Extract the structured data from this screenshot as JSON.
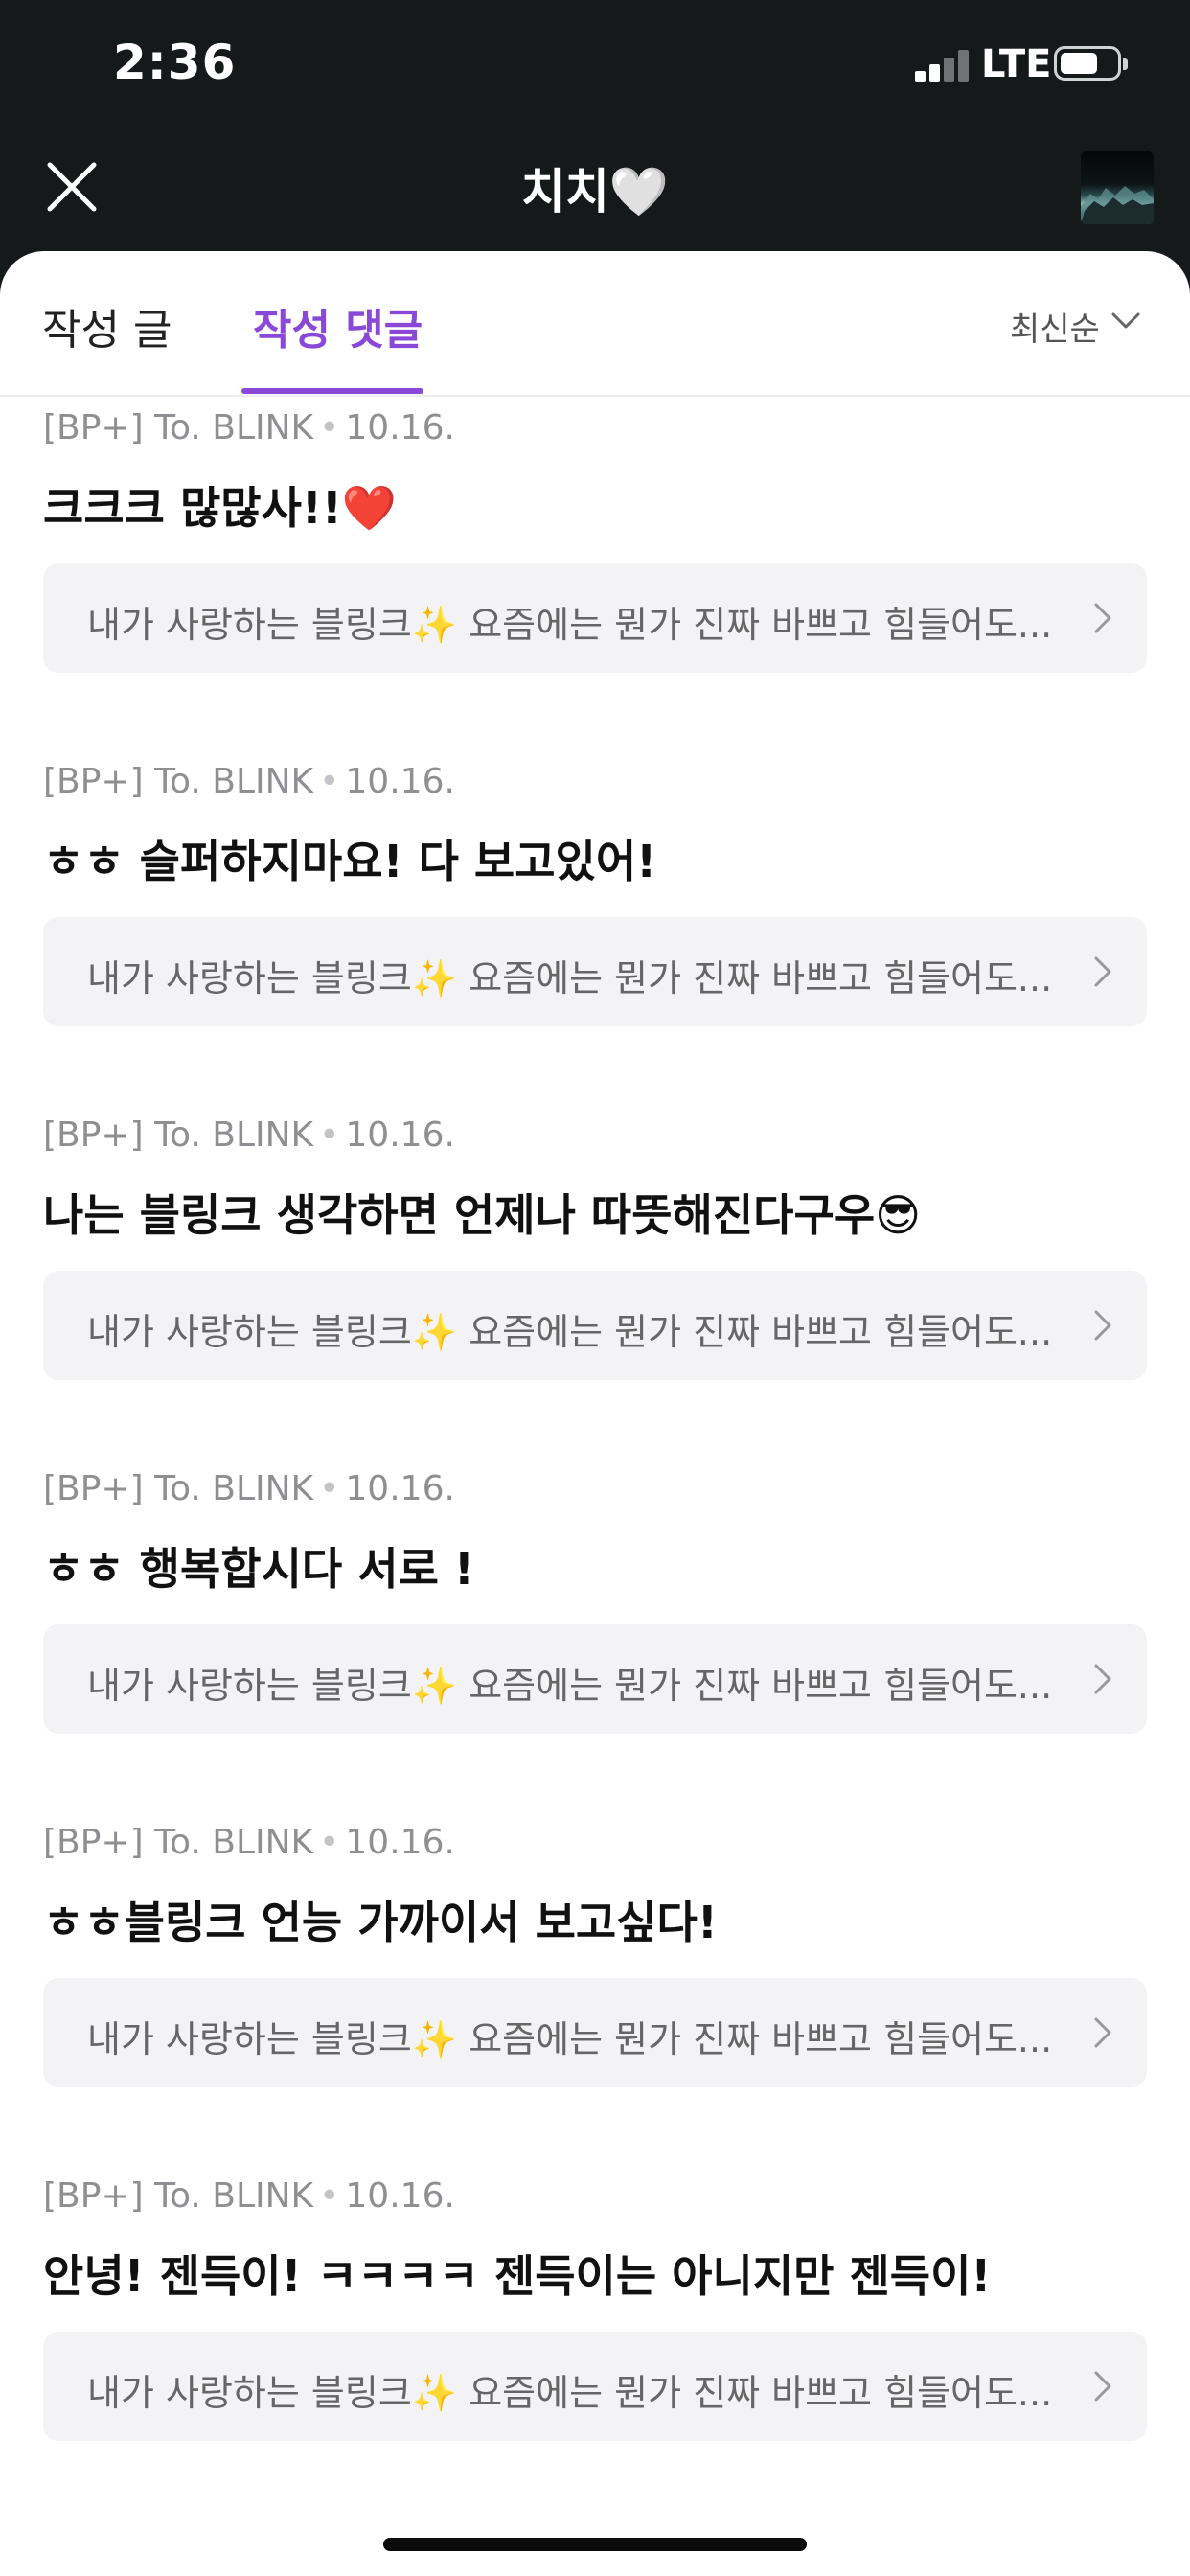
{
  "status_bar": {
    "time": "2:36",
    "network": "LTE"
  },
  "header": {
    "title": "치치🤍",
    "close_icon": "close-icon",
    "avatar_icon": "profile-avatar"
  },
  "tabs": [
    {
      "label": "작성 글",
      "active": false
    },
    {
      "label": "작성 댓글",
      "active": true
    }
  ],
  "sort": {
    "label": "최신순",
    "icon": "chevron-down-icon"
  },
  "accent_color": "#8a48d8",
  "comments": [
    {
      "source": "[BP+] To. BLINK",
      "date": "10.16.",
      "text": "크크크 많많사!!❤️",
      "post_preview": "내가 사랑하는 블링크✨ 요즘에는 뭔가 진짜 바쁘고 힘들어도..."
    },
    {
      "source": "[BP+] To. BLINK",
      "date": "10.16.",
      "text": "ㅎㅎ 슬퍼하지마요! 다 보고있어!",
      "post_preview": "내가 사랑하는 블링크✨ 요즘에는 뭔가 진짜 바쁘고 힘들어도..."
    },
    {
      "source": "[BP+] To. BLINK",
      "date": "10.16.",
      "text": "나는 블링크 생각하면 언제나 따뜻해진다구우😎",
      "post_preview": "내가 사랑하는 블링크✨ 요즘에는 뭔가 진짜 바쁘고 힘들어도..."
    },
    {
      "source": "[BP+] To. BLINK",
      "date": "10.16.",
      "text": "ㅎㅎ 행복합시다 서로 !",
      "post_preview": "내가 사랑하는 블링크✨ 요즘에는 뭔가 진짜 바쁘고 힘들어도..."
    },
    {
      "source": "[BP+] To. BLINK",
      "date": "10.16.",
      "text": "ㅎㅎ블링크 언능 가까이서 보고싶다!",
      "post_preview": "내가 사랑하는 블링크✨ 요즘에는 뭔가 진짜 바쁘고 힘들어도..."
    },
    {
      "source": "[BP+] To. BLINK",
      "date": "10.16.",
      "text": "안녕! 젠득이! ㅋㅋㅋㅋ 젠득이는 아니지만 젠득이!",
      "post_preview": "내가 사랑하는 블링크✨ 요즘에는 뭔가 진짜 바쁘고 힘들어도..."
    }
  ]
}
